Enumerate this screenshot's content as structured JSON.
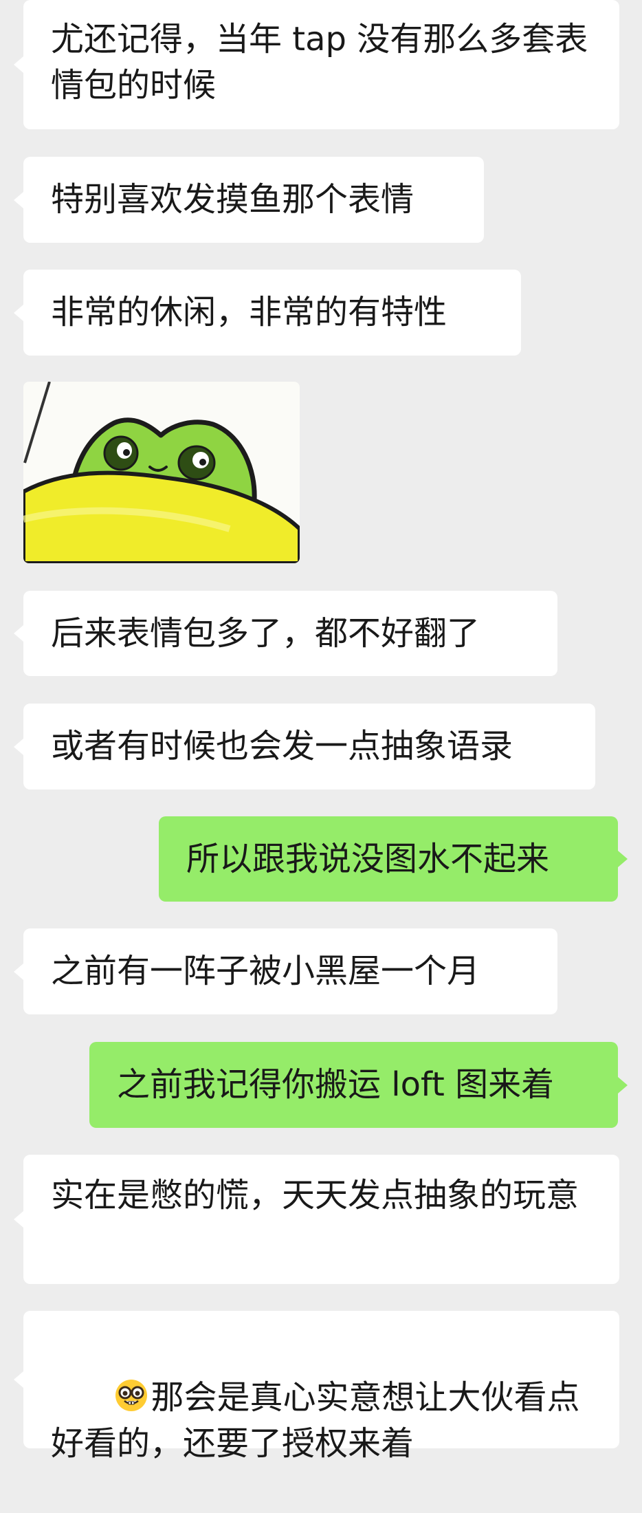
{
  "messages": [
    {
      "side": "left",
      "text": "尤还记得，当年 tap 没有那么多套表情包的时候"
    },
    {
      "side": "left",
      "text": "特别喜欢发摸鱼那个表情"
    },
    {
      "side": "left",
      "text": "非常的休闲，非常的有特性"
    },
    {
      "side": "left",
      "sticker": "frog-peeking-sticker"
    },
    {
      "side": "left",
      "text": "后来表情包多了，都不好翻了"
    },
    {
      "side": "left",
      "text": "或者有时候也会发一点抽象语录"
    },
    {
      "side": "right",
      "text": "所以跟我说没图水不起来"
    },
    {
      "side": "left",
      "text": "之前有一阵子被小黑屋一个月"
    },
    {
      "side": "right",
      "text": "之前我记得你搬运 loft 图来着"
    },
    {
      "side": "left",
      "text": "实在是憋的慌，天天发点抽象的玩意"
    },
    {
      "side": "left",
      "emoji": "nerd-face-icon",
      "text": "那会是真心实意想让大伙看点好看的，还要了授权来着"
    }
  ],
  "colors": {
    "background": "#ededed",
    "incoming_bubble": "#ffffff",
    "outgoing_bubble": "#95ec69",
    "text": "#191919"
  }
}
